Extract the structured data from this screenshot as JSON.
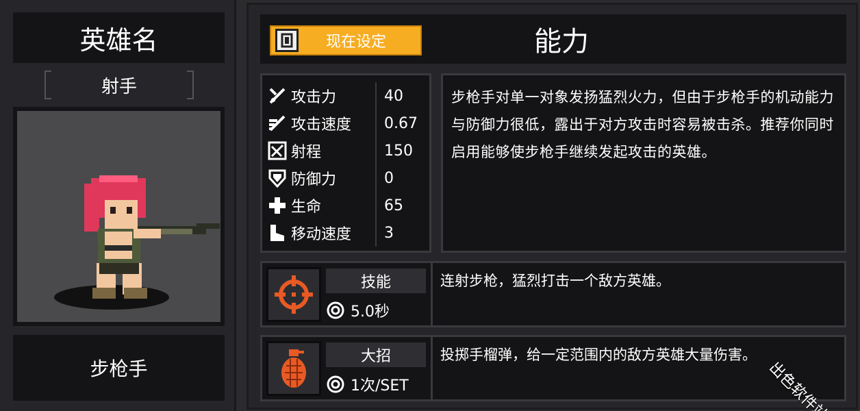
{
  "left": {
    "hero_title": "英雄名",
    "hero_class": "射手",
    "unit_name": "步枪手"
  },
  "header": {
    "set_button_label": "现在设定",
    "panel_title": "能力"
  },
  "stats": [
    {
      "icon": "sword-icon",
      "label": "攻击力",
      "value": "40"
    },
    {
      "icon": "attack-speed-icon",
      "label": "攻击速度",
      "value": "0.67"
    },
    {
      "icon": "range-icon",
      "label": "射程",
      "value": "150"
    },
    {
      "icon": "shield-icon",
      "label": "防御力",
      "value": "0"
    },
    {
      "icon": "health-cross-icon",
      "label": "生命",
      "value": "65"
    },
    {
      "icon": "boot-icon",
      "label": "移动速度",
      "value": "3"
    }
  ],
  "description": "步枪手对单一对象发扬猛烈火力，但由于步枪手的机动能力与防御力很低，露出于对方攻击时容易被击杀。推荐你同时启用能够使步枪手继续发起攻击的英雄。",
  "skill": {
    "tag": "技能",
    "info": "5.0秒",
    "icon": "crosshair-icon",
    "desc": "连射步枪，猛烈打击一个敌方英雄。"
  },
  "ultimate": {
    "tag": "大招",
    "info": "1次/SET",
    "icon": "grenade-icon",
    "desc": "投掷手榴弹，给一定范围内的敌方英雄大量伤害。"
  },
  "watermark": "出色软件站",
  "colors": {
    "accent": "#f7ad22",
    "panel_bg": "#141416",
    "frame_bg": "#26262a",
    "icon_orange": "#e85a24"
  }
}
